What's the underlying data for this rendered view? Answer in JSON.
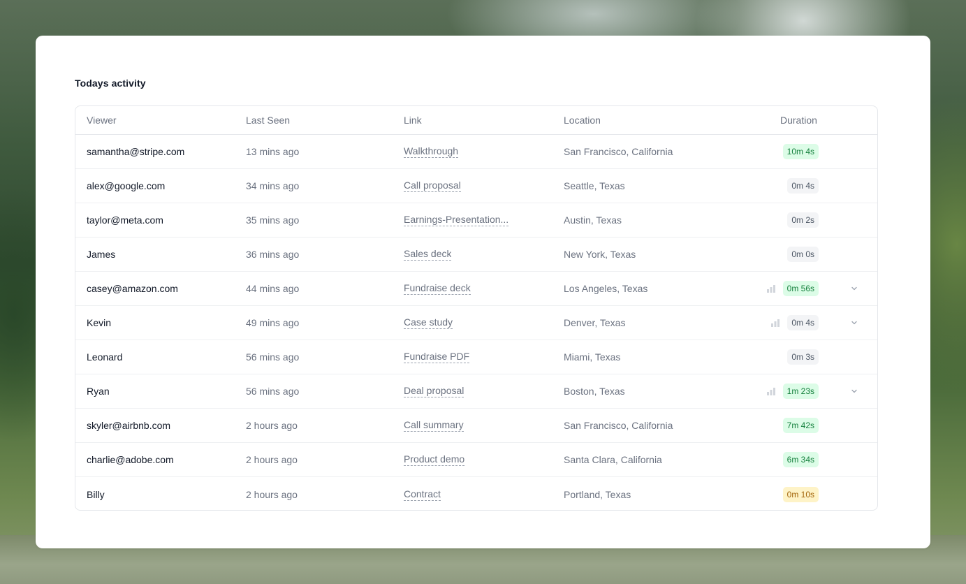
{
  "card": {
    "title": "Todays activity"
  },
  "table": {
    "headers": {
      "viewer": "Viewer",
      "last_seen": "Last Seen",
      "link": "Link",
      "location": "Location",
      "duration": "Duration"
    },
    "rows": [
      {
        "viewer": "samantha@stripe.com",
        "last_seen": "13 mins ago",
        "link": "Walkthrough",
        "location": "San Francisco, California",
        "duration": "10m 4s",
        "duration_color": "green",
        "has_chart_icon": false,
        "has_expand": false
      },
      {
        "viewer": "alex@google.com",
        "last_seen": "34 mins ago",
        "link": "Call proposal",
        "location": "Seattle, Texas",
        "duration": "0m 4s",
        "duration_color": "gray",
        "has_chart_icon": false,
        "has_expand": false
      },
      {
        "viewer": "taylor@meta.com",
        "last_seen": "35 mins ago",
        "link": "Earnings-Presentation...",
        "location": "Austin, Texas",
        "duration": "0m 2s",
        "duration_color": "gray",
        "has_chart_icon": false,
        "has_expand": false
      },
      {
        "viewer": "James",
        "last_seen": "36 mins ago",
        "link": "Sales deck",
        "location": "New York, Texas",
        "duration": "0m 0s",
        "duration_color": "gray",
        "has_chart_icon": false,
        "has_expand": false
      },
      {
        "viewer": "casey@amazon.com",
        "last_seen": "44 mins ago",
        "link": "Fundraise deck",
        "location": "Los Angeles, Texas",
        "duration": "0m 56s",
        "duration_color": "green",
        "has_chart_icon": true,
        "has_expand": true
      },
      {
        "viewer": "Kevin",
        "last_seen": "49 mins ago",
        "link": "Case study",
        "location": "Denver, Texas",
        "duration": "0m 4s",
        "duration_color": "gray",
        "has_chart_icon": true,
        "has_expand": true
      },
      {
        "viewer": "Leonard",
        "last_seen": "56 mins ago",
        "link": "Fundraise PDF",
        "location": "Miami, Texas",
        "duration": "0m 3s",
        "duration_color": "gray",
        "has_chart_icon": false,
        "has_expand": false
      },
      {
        "viewer": "Ryan",
        "last_seen": "56 mins ago",
        "link": "Deal proposal",
        "location": "Boston, Texas",
        "duration": "1m 23s",
        "duration_color": "green",
        "has_chart_icon": true,
        "has_expand": true
      },
      {
        "viewer": "skyler@airbnb.com",
        "last_seen": "2 hours ago",
        "link": "Call summary",
        "location": "San Francisco, California",
        "duration": "7m 42s",
        "duration_color": "green",
        "has_chart_icon": false,
        "has_expand": false
      },
      {
        "viewer": "charlie@adobe.com",
        "last_seen": "2 hours ago",
        "link": "Product demo",
        "location": "Santa Clara, California",
        "duration": "6m 34s",
        "duration_color": "green",
        "has_chart_icon": false,
        "has_expand": false
      },
      {
        "viewer": "Billy",
        "last_seen": "2 hours ago",
        "link": "Contract",
        "location": "Portland, Texas",
        "duration": "0m 10s",
        "duration_color": "yellow",
        "has_chart_icon": false,
        "has_expand": false
      }
    ]
  },
  "icons": {
    "chart": "bar-chart-icon",
    "expand": "chevron-down-icon"
  },
  "colors": {
    "green_badge_bg": "#dcfce7",
    "green_badge_text": "#15803d",
    "gray_badge_bg": "#f3f4f6",
    "yellow_badge_bg": "#fef3c7"
  }
}
